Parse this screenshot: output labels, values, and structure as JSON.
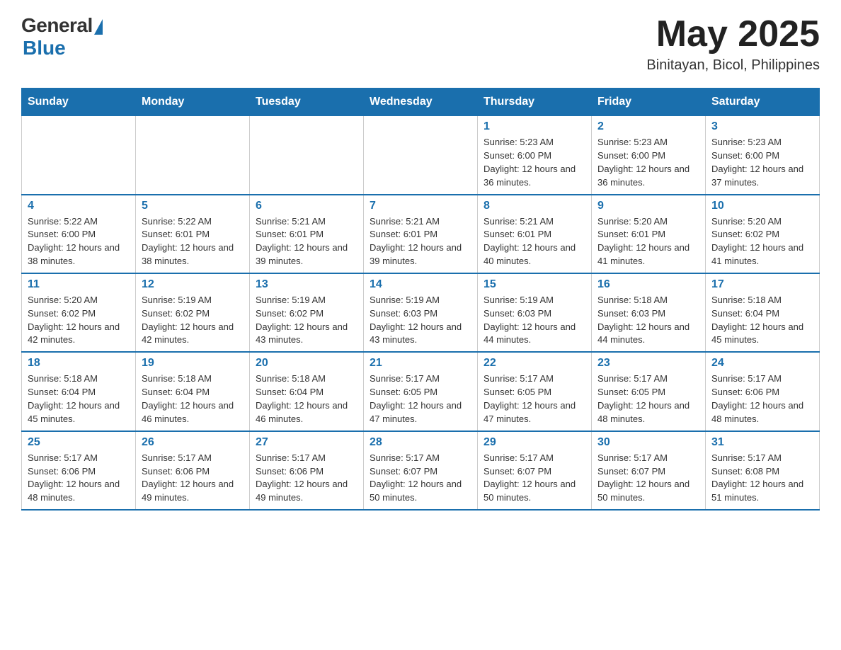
{
  "header": {
    "logo_general": "General",
    "logo_blue": "Blue",
    "month_year": "May 2025",
    "location": "Binitayan, Bicol, Philippines"
  },
  "days_of_week": [
    "Sunday",
    "Monday",
    "Tuesday",
    "Wednesday",
    "Thursday",
    "Friday",
    "Saturday"
  ],
  "weeks": [
    [
      {
        "day": "",
        "info": ""
      },
      {
        "day": "",
        "info": ""
      },
      {
        "day": "",
        "info": ""
      },
      {
        "day": "",
        "info": ""
      },
      {
        "day": "1",
        "info": "Sunrise: 5:23 AM\nSunset: 6:00 PM\nDaylight: 12 hours and 36 minutes."
      },
      {
        "day": "2",
        "info": "Sunrise: 5:23 AM\nSunset: 6:00 PM\nDaylight: 12 hours and 36 minutes."
      },
      {
        "day": "3",
        "info": "Sunrise: 5:23 AM\nSunset: 6:00 PM\nDaylight: 12 hours and 37 minutes."
      }
    ],
    [
      {
        "day": "4",
        "info": "Sunrise: 5:22 AM\nSunset: 6:00 PM\nDaylight: 12 hours and 38 minutes."
      },
      {
        "day": "5",
        "info": "Sunrise: 5:22 AM\nSunset: 6:01 PM\nDaylight: 12 hours and 38 minutes."
      },
      {
        "day": "6",
        "info": "Sunrise: 5:21 AM\nSunset: 6:01 PM\nDaylight: 12 hours and 39 minutes."
      },
      {
        "day": "7",
        "info": "Sunrise: 5:21 AM\nSunset: 6:01 PM\nDaylight: 12 hours and 39 minutes."
      },
      {
        "day": "8",
        "info": "Sunrise: 5:21 AM\nSunset: 6:01 PM\nDaylight: 12 hours and 40 minutes."
      },
      {
        "day": "9",
        "info": "Sunrise: 5:20 AM\nSunset: 6:01 PM\nDaylight: 12 hours and 41 minutes."
      },
      {
        "day": "10",
        "info": "Sunrise: 5:20 AM\nSunset: 6:02 PM\nDaylight: 12 hours and 41 minutes."
      }
    ],
    [
      {
        "day": "11",
        "info": "Sunrise: 5:20 AM\nSunset: 6:02 PM\nDaylight: 12 hours and 42 minutes."
      },
      {
        "day": "12",
        "info": "Sunrise: 5:19 AM\nSunset: 6:02 PM\nDaylight: 12 hours and 42 minutes."
      },
      {
        "day": "13",
        "info": "Sunrise: 5:19 AM\nSunset: 6:02 PM\nDaylight: 12 hours and 43 minutes."
      },
      {
        "day": "14",
        "info": "Sunrise: 5:19 AM\nSunset: 6:03 PM\nDaylight: 12 hours and 43 minutes."
      },
      {
        "day": "15",
        "info": "Sunrise: 5:19 AM\nSunset: 6:03 PM\nDaylight: 12 hours and 44 minutes."
      },
      {
        "day": "16",
        "info": "Sunrise: 5:18 AM\nSunset: 6:03 PM\nDaylight: 12 hours and 44 minutes."
      },
      {
        "day": "17",
        "info": "Sunrise: 5:18 AM\nSunset: 6:04 PM\nDaylight: 12 hours and 45 minutes."
      }
    ],
    [
      {
        "day": "18",
        "info": "Sunrise: 5:18 AM\nSunset: 6:04 PM\nDaylight: 12 hours and 45 minutes."
      },
      {
        "day": "19",
        "info": "Sunrise: 5:18 AM\nSunset: 6:04 PM\nDaylight: 12 hours and 46 minutes."
      },
      {
        "day": "20",
        "info": "Sunrise: 5:18 AM\nSunset: 6:04 PM\nDaylight: 12 hours and 46 minutes."
      },
      {
        "day": "21",
        "info": "Sunrise: 5:17 AM\nSunset: 6:05 PM\nDaylight: 12 hours and 47 minutes."
      },
      {
        "day": "22",
        "info": "Sunrise: 5:17 AM\nSunset: 6:05 PM\nDaylight: 12 hours and 47 minutes."
      },
      {
        "day": "23",
        "info": "Sunrise: 5:17 AM\nSunset: 6:05 PM\nDaylight: 12 hours and 48 minutes."
      },
      {
        "day": "24",
        "info": "Sunrise: 5:17 AM\nSunset: 6:06 PM\nDaylight: 12 hours and 48 minutes."
      }
    ],
    [
      {
        "day": "25",
        "info": "Sunrise: 5:17 AM\nSunset: 6:06 PM\nDaylight: 12 hours and 48 minutes."
      },
      {
        "day": "26",
        "info": "Sunrise: 5:17 AM\nSunset: 6:06 PM\nDaylight: 12 hours and 49 minutes."
      },
      {
        "day": "27",
        "info": "Sunrise: 5:17 AM\nSunset: 6:06 PM\nDaylight: 12 hours and 49 minutes."
      },
      {
        "day": "28",
        "info": "Sunrise: 5:17 AM\nSunset: 6:07 PM\nDaylight: 12 hours and 50 minutes."
      },
      {
        "day": "29",
        "info": "Sunrise: 5:17 AM\nSunset: 6:07 PM\nDaylight: 12 hours and 50 minutes."
      },
      {
        "day": "30",
        "info": "Sunrise: 5:17 AM\nSunset: 6:07 PM\nDaylight: 12 hours and 50 minutes."
      },
      {
        "day": "31",
        "info": "Sunrise: 5:17 AM\nSunset: 6:08 PM\nDaylight: 12 hours and 51 minutes."
      }
    ]
  ]
}
